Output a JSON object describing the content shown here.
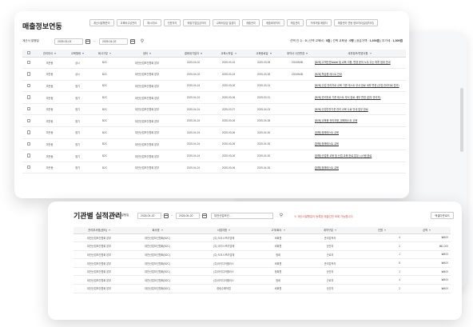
{
  "top": {
    "title": "매출정보연동",
    "tabs": [
      "계산서발행관리",
      "교육비수납관리",
      "매시/취소",
      "전표처리",
      "매출기업입금처리",
      "교육비입금 일괄이",
      "매출관리",
      "매출회계처리",
      "매입관리",
      "거래처별 매출처",
      "매출관리 연동 정보처리(일괄처리)"
    ],
    "filter_label": "계산서 발행일",
    "date_from": "2025-03-01",
    "date_to": "2025-04-02",
    "summary_parts": [
      "선택 건 수 : ",
      "0",
      " | 선택 교육비 : ",
      "0원",
      " | 선택 교육생 : ",
      "0명",
      " | 공급가액 : ",
      "1,300원",
      " | 부가세 : ",
      "1,300원"
    ],
    "columns": [
      "",
      "관리부서",
      "교육형태",
      "회사구분",
      "센터",
      "결제대기일자",
      "교육시작일",
      "교육종료일",
      "계약서 사전변경",
      "세부정보/변경사항"
    ],
    "rows": [
      [
        "미관동",
        "상시",
        "B2C",
        "대전산업보건협회 본부",
        "2025-04-02",
        "2025-03-24",
        "2025-03-28",
        "2024W4B",
        "[B2B] 고객안전Wallet 및 교육 이용, 변경 문의 노무 주는 하루 범위 안내"
      ],
      [
        "미관동",
        "상시",
        "B2C",
        "대전산업보건협회 본부",
        "2025-04-02",
        "2025-03-24",
        "2025-03-28",
        "2024W4B",
        "[B2B] 학습용 테스트 안내"
      ],
      [
        "미관동",
        "정기",
        "B2C",
        "대전산업보건협회 본부",
        "2025-04-24",
        "2025-03-06",
        "2025-03-31",
        "",
        "[B2B] 산업 관리자로 교육 기준 테스트 부서 완료 세부 변경 (산업 관리자로 업무)"
      ],
      [
        "미관동",
        "정기",
        "B2C",
        "대전산업보건협회 본부",
        "2025-04-24",
        "2025-03-06",
        "2025-03-31",
        "",
        "[B2B] 관리자로 기준 테스트 부서 완료 세부 변경 (업무 관리자)"
      ],
      [
        "미관동",
        "정기",
        "B2C",
        "대전산업보건협회 본부",
        "2025-04-24",
        "2025-03-07",
        "2025-04-03",
        "",
        "[B2B] 산업안전기준 관리 교육 수료 안내 업무 완료"
      ],
      [
        "미관동",
        "정기",
        "B2C",
        "대전산업보건협회 본부",
        "2025-04-24",
        "2025-03-06",
        "2025-04-08",
        "",
        "[B2B] 교육용 관리자용_정해테스트 교육"
      ],
      [
        "미관동",
        "정기",
        "B2C",
        "대전산업보건협회 본부",
        "2025-04-24",
        "2025-03-06",
        "2025-04-30",
        "",
        "[정해] 정해테스트 교육"
      ],
      [
        "미관동",
        "정기",
        "B2C",
        "대전산업보건협회 본부",
        "2025-04-24",
        "2025-03-06",
        "2025-04-30",
        "",
        "[정해] 정해테스트 교육"
      ],
      [
        "미관동",
        "정기",
        "B2C",
        "대전산업보건협회 본부",
        "2025-04-24",
        "2025-03-06",
        "2025-04-30",
        "",
        "[정해] 산업용 교육 및 산업 교육 완료 업무 시스템 완료"
      ],
      [
        "미관동",
        "정기",
        "B2C",
        "대전산업보건협회 본부",
        "2025-04-24",
        "2025-03-06",
        "2025-04-30",
        "",
        "[정해] 정해테스트 교육"
      ]
    ]
  },
  "bottom": {
    "title": "기관별 실적관리",
    "filter_label": "계산서발행일",
    "date_from": "2025-04-20",
    "date_to": "2025-05-20",
    "select_value": "대전산업보건...",
    "note": "※ 계산서발행일이 등록된 매출건만 조회 가능합니다.",
    "button": "엑셀다운로드",
    "columns": [
      "관리부서명(센터)",
      "회사명",
      "사업자명",
      "고객/회사",
      "계약구분",
      "인원",
      "금액"
    ],
    "rows": [
      [
        "대전산업보건협회 본부",
        "대전산업보건협회(B2C)",
        "(주) 도도스프리덤에",
        "비회원",
        "관리감독자",
        "4",
        "₩400"
      ],
      [
        "대전산업보건협회 본부",
        "대전산업보건협회(B2C)",
        "(주) 아이스프리덤에",
        "비회원",
        "산안자",
        "2",
        "₩1,000"
      ],
      [
        "대전산업보건협회 본부",
        "대전산업보건협회(B2C)",
        "(주) 도도스프리덤에",
        "정회",
        "근로자",
        "1",
        "₩400"
      ],
      [
        "대전산업보건협회 본부",
        "대전산업보건협회(B2C)",
        "(주)아이디어플러스",
        "비회원",
        "관리감독자",
        "8",
        "₩400"
      ],
      [
        "대전산업보건협회 본부",
        "대전산업보건협회(B2C)",
        "(주)아이디어플러스",
        "정회원",
        "산안자",
        "1",
        "₩400"
      ],
      [
        "대전산업보건협회 본부",
        "대전산업보건협회(B2C)",
        "(주)아이디어플러스",
        "정회",
        "근로자",
        "4",
        "₩400"
      ],
      [
        "대전산업보건협회 본부",
        "대전산업보건협회(B2C)",
        "한림수해작업",
        "비회원",
        "산안자",
        "2",
        "₩400"
      ]
    ]
  }
}
